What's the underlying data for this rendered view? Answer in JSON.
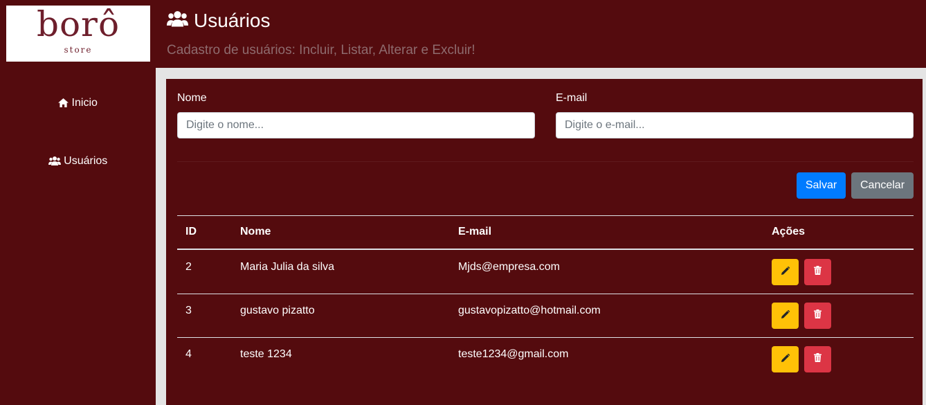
{
  "brand": {
    "name": "borô",
    "sub": "store"
  },
  "sidebar": {
    "items": [
      {
        "label": "Inicio",
        "icon": "home-icon"
      },
      {
        "label": "Usuários",
        "icon": "users-icon"
      }
    ]
  },
  "header": {
    "title": "Usuários",
    "subtitle": "Cadastro de usuários: Incluir, Listar, Alterar e Excluir!"
  },
  "form": {
    "name_label": "Nome",
    "name_placeholder": "Digite o nome...",
    "name_value": "",
    "email_label": "E-mail",
    "email_placeholder": "Digite o e-mail...",
    "email_value": "",
    "save_label": "Salvar",
    "cancel_label": "Cancelar"
  },
  "table": {
    "headers": {
      "id": "ID",
      "name": "Nome",
      "email": "E-mail",
      "actions": "Ações"
    },
    "rows": [
      {
        "id": "2",
        "name": "Maria Julia da silva",
        "email": "Mjds@empresa.com"
      },
      {
        "id": "3",
        "name": "gustavo pizatto",
        "email": "gustavopizatto@hotmail.com"
      },
      {
        "id": "4",
        "name": "teste 1234",
        "email": "teste1234@gmail.com"
      }
    ]
  },
  "colors": {
    "background": "#540b0e",
    "primary": "#007bff",
    "secondary": "#6c757d",
    "warning": "#ffc107",
    "danger": "#dc3545"
  }
}
